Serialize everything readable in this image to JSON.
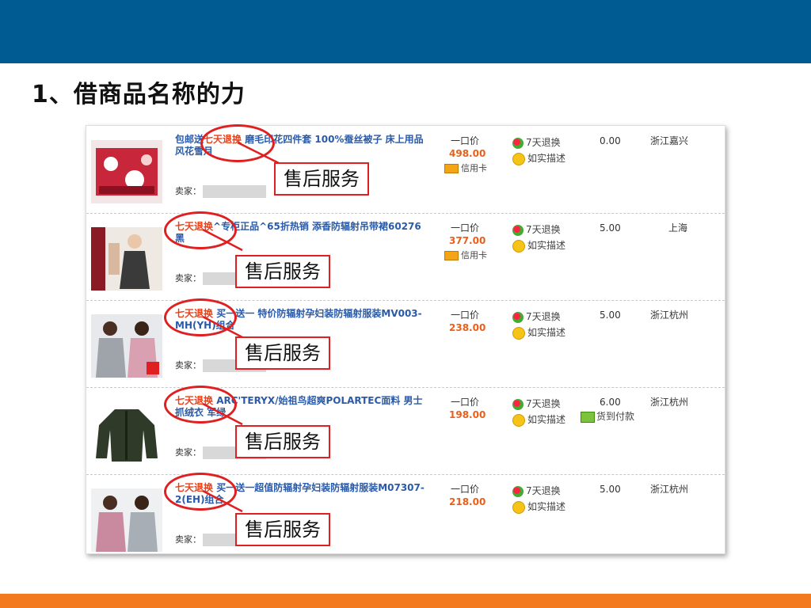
{
  "slide": {
    "title": "1、借商品名称的力"
  },
  "common": {
    "seller_label": "卖家：",
    "price_label": "一口价",
    "service_return": "7天退换",
    "service_desc": "如实描述"
  },
  "callout_label": "售后服务",
  "listings": [
    {
      "title_pre": "包邮送",
      "title_hl": "七天退换",
      "title_post": " 磨毛印花四件套 100%蚕丝被子 床上用品 风花雪月",
      "price": "498.00",
      "payment": "信用卡",
      "shipping": "0.00",
      "location": "浙江嘉兴"
    },
    {
      "title_pre": "",
      "title_hl": "七天退换",
      "title_post": "^专柜正品^65折热销 添香防辐射吊带裙60276黑",
      "price": "377.00",
      "payment": "信用卡",
      "shipping": "5.00",
      "location": "上海"
    },
    {
      "title_pre": "",
      "title_hl": "七天退换",
      "title_post": " 买一送一 特价防辐射孕妇装防辐射服装MV003-MH(YH)组合",
      "price": "238.00",
      "payment": "",
      "shipping": "5.00",
      "location": "浙江杭州"
    },
    {
      "title_pre": "",
      "title_hl": "七天退换",
      "title_post": " ARC'TERYX/始祖鸟超爽POLARTEC面料 男士抓绒衣 军绿",
      "price": "198.00",
      "payment": "货到付款",
      "shipping": "6.00",
      "location": "浙江杭州"
    },
    {
      "title_pre": "",
      "title_hl": "七天退换",
      "title_post": " 买一送一超值防辐射孕妇装防辐射服装M07307-2(EH)组合",
      "price": "218.00",
      "payment": "",
      "shipping": "5.00",
      "location": "浙江杭州"
    }
  ],
  "colors": {
    "header_band": "#005b92",
    "footer_band": "#f47a1f",
    "annotation": "#e02020",
    "link": "#2a5aa8",
    "highlight": "#e8411a"
  }
}
